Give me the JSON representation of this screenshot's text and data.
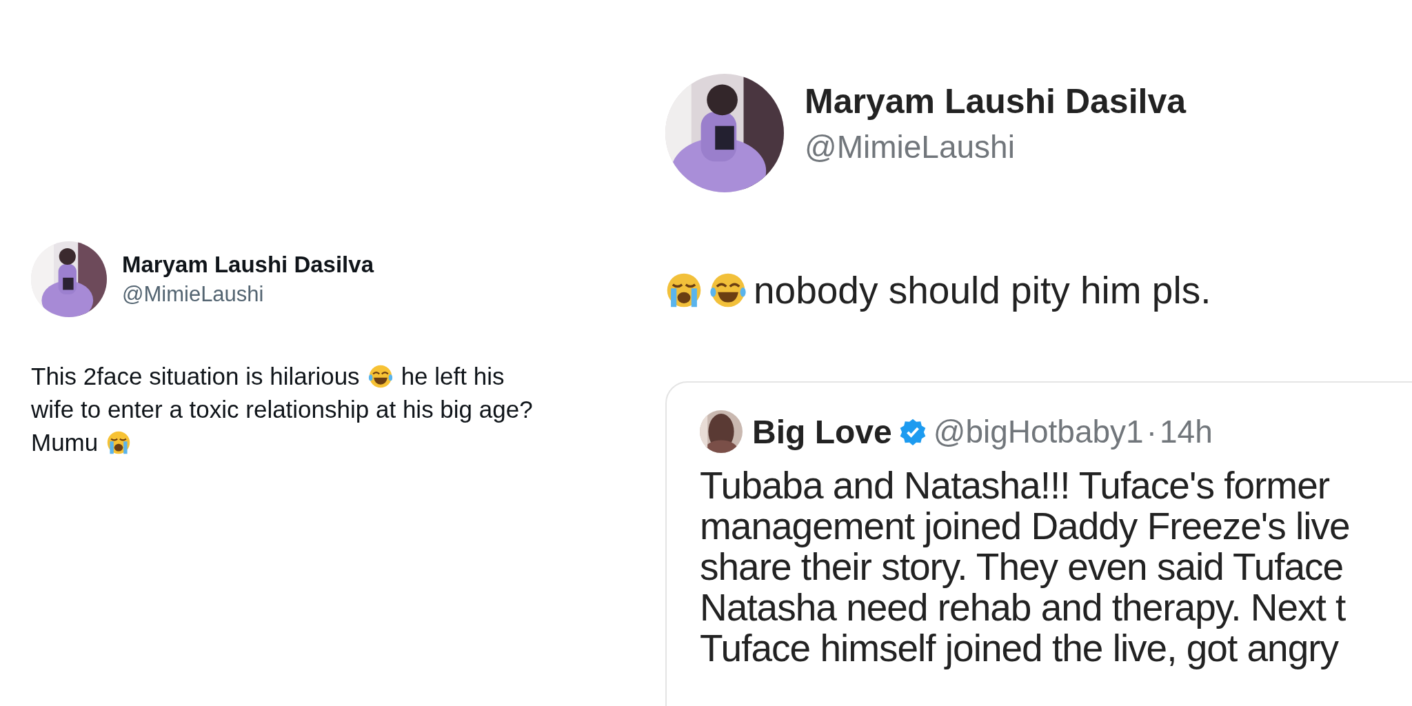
{
  "left_post": {
    "author": {
      "name": "Maryam Laushi Dasilva",
      "handle": "@MimieLaushi"
    },
    "body": [
      [
        {
          "kind": "text",
          "text": "This 2face situation is hilarious"
        },
        {
          "kind": "laughing_emoji"
        },
        {
          "kind": "text",
          "text": "he left his"
        }
      ],
      [
        {
          "kind": "text",
          "text": "wife to enter a toxic relationship at his big age?"
        }
      ],
      [
        {
          "kind": "text",
          "text": "Mumu"
        },
        {
          "kind": "crying_emoji"
        }
      ]
    ]
  },
  "right_post": {
    "author": {
      "name": "Maryam Laushi Dasilva",
      "handle": "@MimieLaushi"
    },
    "body": [
      [
        {
          "kind": "crying_emoji"
        },
        {
          "kind": "laughing_emoji"
        },
        {
          "kind": "text",
          "text": "nobody should pity him pls."
        }
      ]
    ],
    "quoted_post": {
      "author": {
        "name": "Big Love",
        "verified": true,
        "handle": "@bigHotbaby1",
        "separator": "·",
        "time": "14h"
      },
      "body": [
        [
          {
            "kind": "text",
            "text": "Tubaba and Natasha!!! Tuface's former"
          }
        ],
        [
          {
            "kind": "text",
            "text": "management joined Daddy Freeze's live"
          }
        ],
        [
          {
            "kind": "text",
            "text": "share their story. They even said Tuface"
          }
        ],
        [
          {
            "kind": "text",
            "text": "Natasha need rehab and therapy. Next t"
          }
        ],
        [
          {
            "kind": "text",
            "text": "Tuface himself joined the live, got angry"
          }
        ]
      ]
    }
  }
}
